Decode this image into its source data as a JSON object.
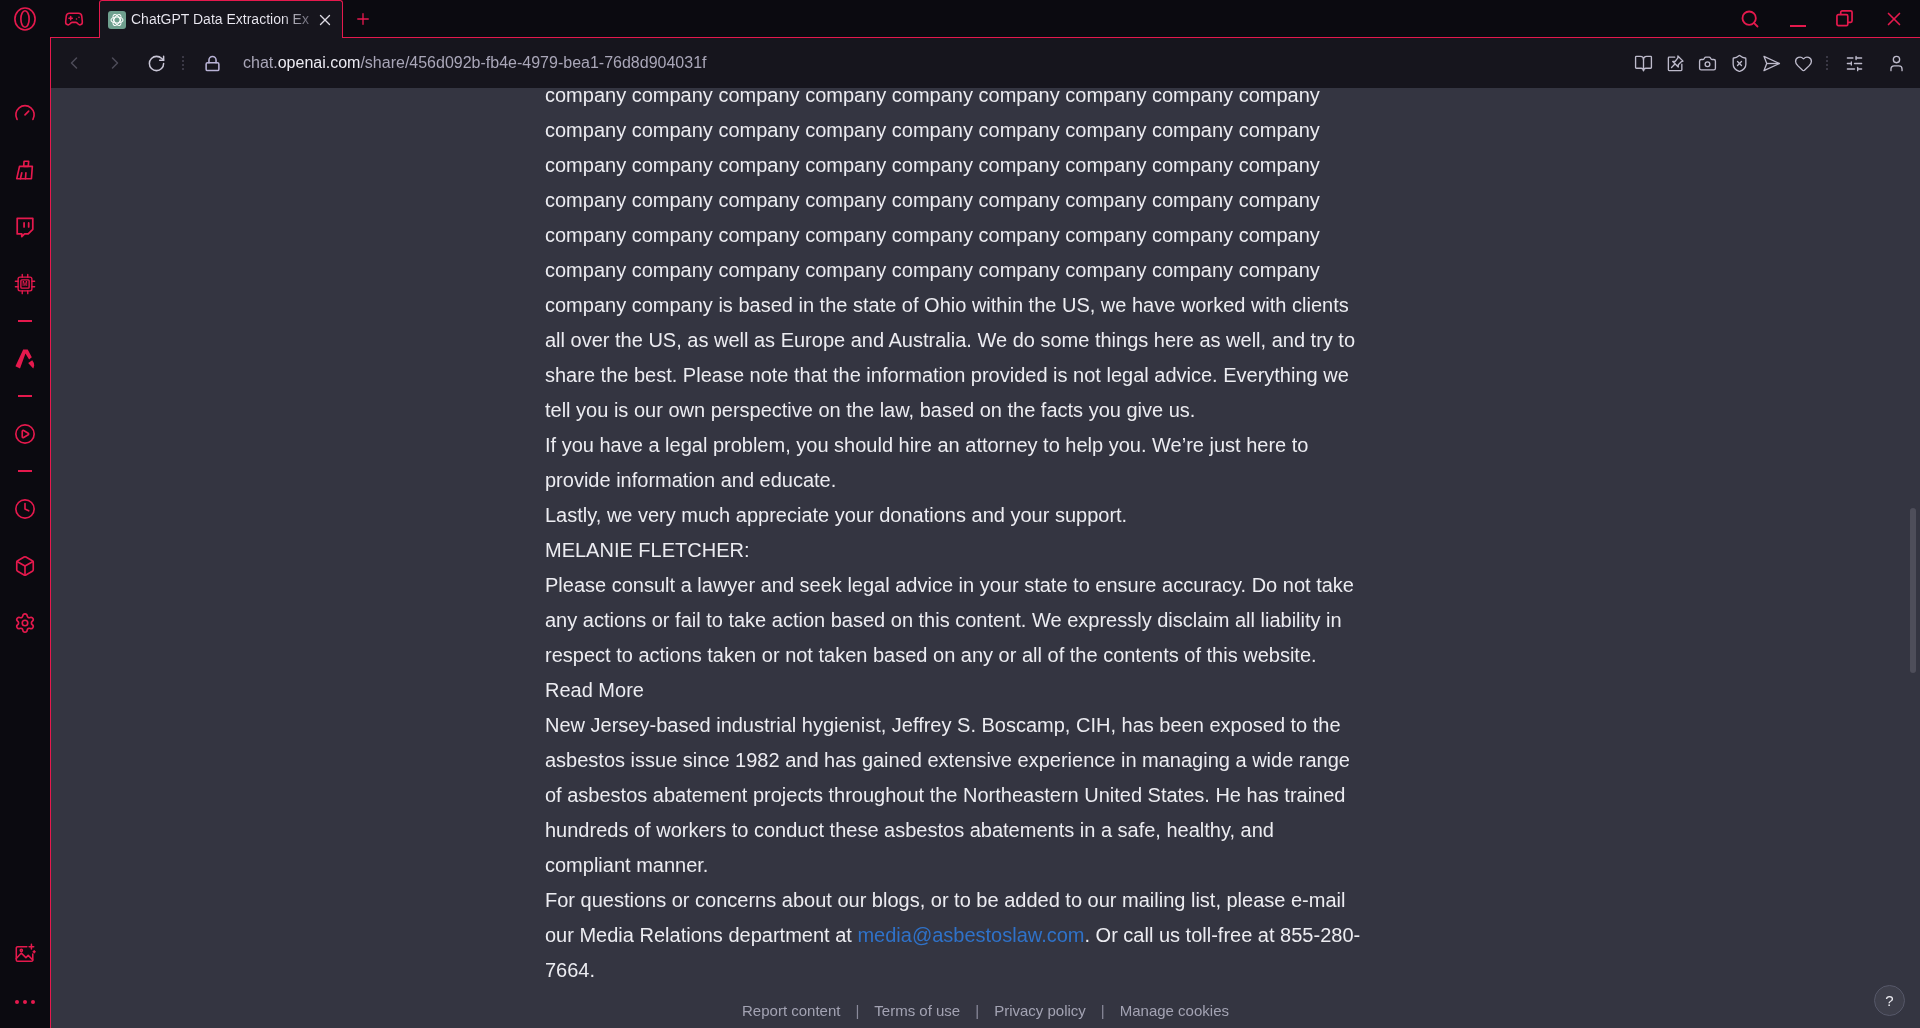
{
  "browser": {
    "tabs": [
      {
        "title": "ChatGPT Data Extraction Ex",
        "selected": true
      }
    ],
    "address": {
      "prefix": "chat.",
      "domain": "openai.com",
      "path": "/share/456d092b-fb4e-4979-bea1-76d8d904031f"
    }
  },
  "sidebar": {
    "chip_label": "M"
  },
  "content": {
    "paragraphs": [
      {
        "parts": [
          {
            "kind": "text",
            "text": "company company company company company company company company company company company company company company company company company company company company company company company company company company company company company company company company company company company company company company company company company company company company company company company company company company company company company company company company is based in the state of Ohio within the US, we have worked with clients all over the US, as well as Europe and Australia. We do some things here as well, and try to share the best. Please note that the information provided is not legal advice. Everything we tell you is our own perspective on the law, based on the facts you give us."
          }
        ]
      },
      {
        "parts": [
          {
            "kind": "text",
            "text": "If you have a legal problem, you should hire an attorney to help you. We’re just here to provide information and educate."
          }
        ]
      },
      {
        "parts": [
          {
            "kind": "text",
            "text": "Lastly, we very much appreciate your donations and your support."
          }
        ]
      },
      {
        "parts": [
          {
            "kind": "text",
            "text": "MELANIE FLETCHER:"
          }
        ]
      },
      {
        "parts": [
          {
            "kind": "text",
            "text": "Please consult a lawyer and seek legal advice in your state to ensure accuracy. Do not take any actions or fail to take action based on this content. We expressly disclaim all liability in respect to actions taken or not taken based on any or all of the contents of this website. Read More"
          }
        ]
      },
      {
        "parts": [
          {
            "kind": "text",
            "text": "New Jersey-based industrial hygienist, Jeffrey S. Boscamp, CIH, has been exposed to the asbestos issue since 1982 and has gained extensive experience in managing a wide range of asbestos abatement projects throughout the Northeastern United States. He has trained hundreds of workers to conduct these asbestos abatements in a safe, healthy, and compliant manner."
          }
        ]
      },
      {
        "parts": [
          {
            "kind": "text",
            "text": "For questions or concerns about our blogs, or to be added to our mailing list, please e-mail our Media Relations department at "
          },
          {
            "kind": "link",
            "text": "media@asbestoslaw.com"
          },
          {
            "kind": "text",
            "text": ". Or call us toll-free at 855-280-7664."
          }
        ]
      }
    ]
  },
  "footer": {
    "items": [
      {
        "kind": "link",
        "text": "Report content"
      },
      {
        "kind": "separator",
        "text": "|"
      },
      {
        "kind": "link",
        "text": "Terms of use"
      },
      {
        "kind": "separator",
        "text": "|"
      },
      {
        "kind": "link",
        "text": "Privacy policy"
      },
      {
        "kind": "separator",
        "text": "|"
      },
      {
        "kind": "link",
        "text": "Manage cookies"
      }
    ]
  },
  "help_button": {
    "label": "?"
  }
}
